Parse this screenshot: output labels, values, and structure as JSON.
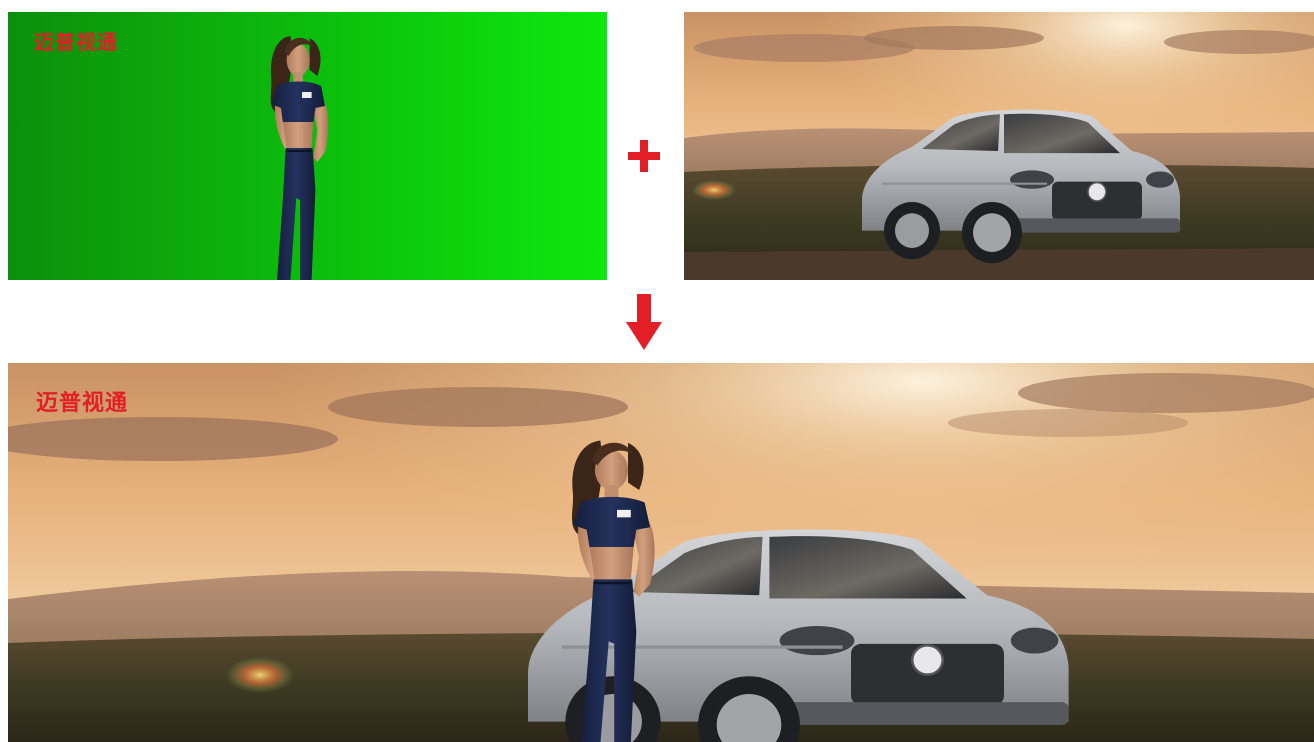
{
  "watermark": {
    "text": "迈普视通",
    "color": "#e21f26"
  },
  "panels": {
    "source_green": {
      "description_icon": "green-screen-photo"
    },
    "source_background": {
      "description_icon": "car-sunset-photo"
    },
    "composite": {
      "description_icon": "composite-photo"
    }
  },
  "operators": {
    "plus_icon": "plus-icon",
    "arrow_icon": "arrow-down-icon",
    "color": "#e21f26"
  },
  "colors": {
    "green_screen": "#0fd60f",
    "sky_warm": "#e6b27a",
    "car_silver": "#b9bcc0",
    "shirt_navy": "#1d2a52"
  }
}
